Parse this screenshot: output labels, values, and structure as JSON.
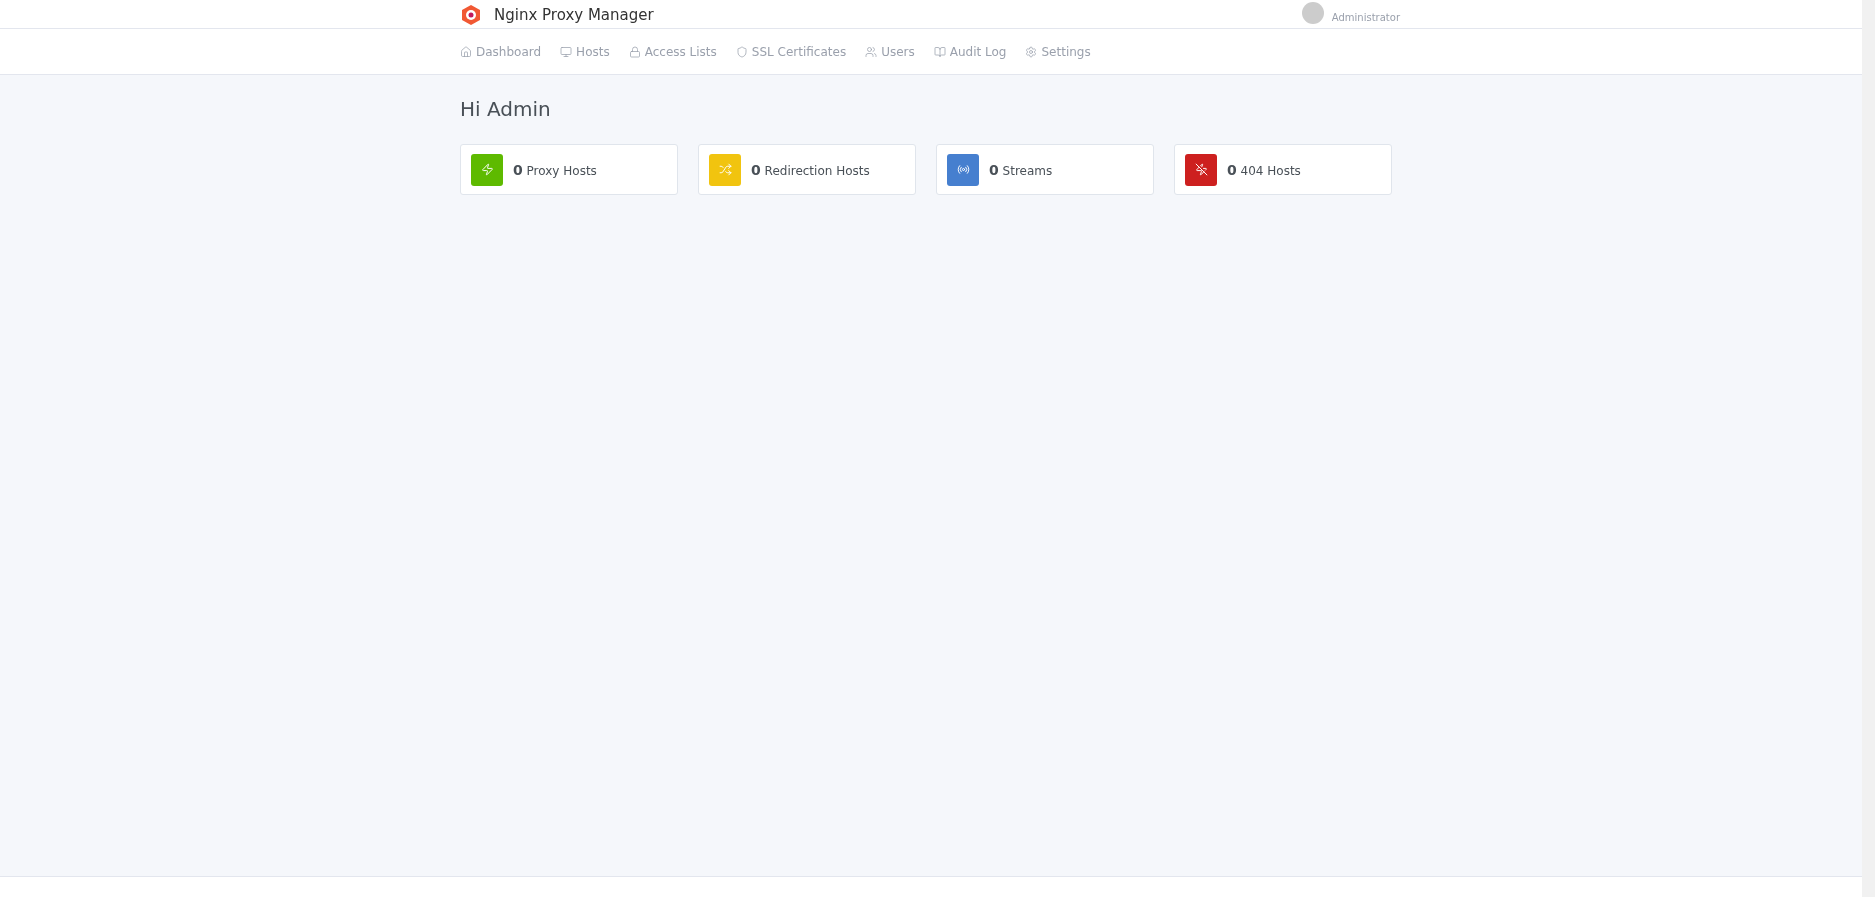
{
  "header": {
    "app_name": "Nginx Proxy Manager",
    "user_role": "Administrator"
  },
  "nav": [
    {
      "label": "Dashboard"
    },
    {
      "label": "Hosts"
    },
    {
      "label": "Access Lists"
    },
    {
      "label": "SSL Certificates"
    },
    {
      "label": "Users"
    },
    {
      "label": "Audit Log"
    },
    {
      "label": "Settings"
    }
  ],
  "greeting": "Hi Admin",
  "stats": [
    {
      "count": "0",
      "label": "Proxy Hosts",
      "color": "#5eba00"
    },
    {
      "count": "0",
      "label": "Redirection Hosts",
      "color": "#f1c40f"
    },
    {
      "count": "0",
      "label": "Streams",
      "color": "#467fcf"
    },
    {
      "count": "0",
      "label": "404 Hosts",
      "color": "#cd201f"
    }
  ]
}
